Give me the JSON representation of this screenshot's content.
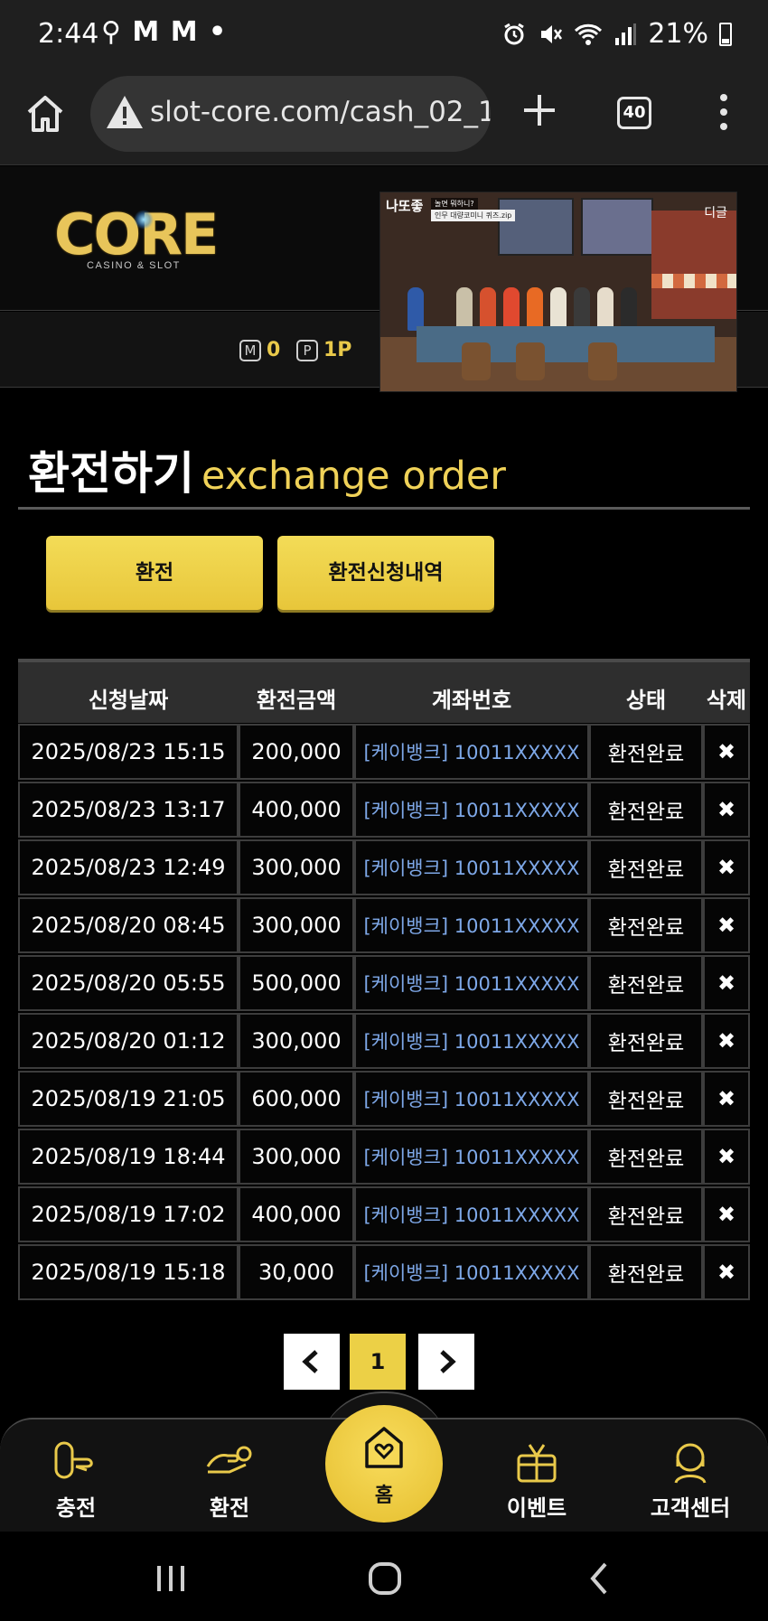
{
  "status_bar": {
    "time": "2:44",
    "indicators": "⚲ M M •",
    "battery_pct": "21%"
  },
  "browser": {
    "url": "slot-core.com/cash_02_1",
    "tab_count": "40",
    "icons": [
      "home-icon",
      "warning-icon",
      "plus-icon",
      "tabs-icon",
      "kebab-icon"
    ]
  },
  "site": {
    "logo_text": "CORE",
    "logo_sub": "CASINO & SLOT",
    "points": [
      {
        "icon": "M",
        "value": "0"
      },
      {
        "icon": "P",
        "value": "1P"
      }
    ]
  },
  "video": {
    "title": "나또좋",
    "subtitle": "놀면 뭐하니?",
    "caption": "인무 대량코미니 퀴즈.zip",
    "corner": "디글"
  },
  "page": {
    "title_ko": "환전하기",
    "title_en": "exchange order",
    "btn_exchange": "환전",
    "btn_history": "환전신청내역"
  },
  "table": {
    "headers": [
      "신청날짜",
      "환전금액",
      "계좌번호",
      "상태",
      "삭제"
    ],
    "rows": [
      {
        "date": "2025/08/23 15:15",
        "amount": "200,000",
        "account": "[케이뱅크] 10011XXXXX",
        "status": "환전완료",
        "delete": "✖"
      },
      {
        "date": "2025/08/23 13:17",
        "amount": "400,000",
        "account": "[케이뱅크] 10011XXXXX",
        "status": "환전완료",
        "delete": "✖"
      },
      {
        "date": "2025/08/23 12:49",
        "amount": "300,000",
        "account": "[케이뱅크] 10011XXXXX",
        "status": "환전완료",
        "delete": "✖"
      },
      {
        "date": "2025/08/20 08:45",
        "amount": "300,000",
        "account": "[케이뱅크] 10011XXXXX",
        "status": "환전완료",
        "delete": "✖"
      },
      {
        "date": "2025/08/20 05:55",
        "amount": "500,000",
        "account": "[케이뱅크] 10011XXXXX",
        "status": "환전완료",
        "delete": "✖"
      },
      {
        "date": "2025/08/20 01:12",
        "amount": "300,000",
        "account": "[케이뱅크] 10011XXXXX",
        "status": "환전완료",
        "delete": "✖"
      },
      {
        "date": "2025/08/19 21:05",
        "amount": "600,000",
        "account": "[케이뱅크] 10011XXXXX",
        "status": "환전완료",
        "delete": "✖"
      },
      {
        "date": "2025/08/19 18:44",
        "amount": "300,000",
        "account": "[케이뱅크] 10011XXXXX",
        "status": "환전완료",
        "delete": "✖"
      },
      {
        "date": "2025/08/19 17:02",
        "amount": "400,000",
        "account": "[케이뱅크] 10011XXXXX",
        "status": "환전완료",
        "delete": "✖"
      },
      {
        "date": "2025/08/19 15:18",
        "amount": "30,000",
        "account": "[케이뱅크] 10011XXXXX",
        "status": "환전완료",
        "delete": "✖"
      }
    ]
  },
  "pagination": {
    "prev": "‹",
    "current": "1",
    "next": "›"
  },
  "bottom_nav": {
    "charge": "충전",
    "exchange": "환전",
    "home": "홈",
    "event": "이벤트",
    "support": "고객센터"
  },
  "colors": {
    "accent": "#ecd046",
    "account_link": "#7ea8e8",
    "background": "#000000"
  }
}
